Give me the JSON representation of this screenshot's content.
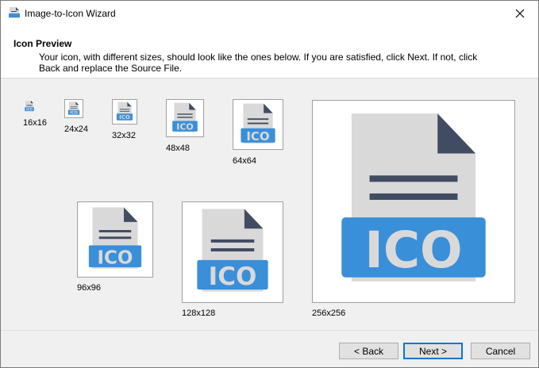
{
  "window": {
    "title": "Image-to-Icon Wizard"
  },
  "header": {
    "title": "Icon Preview",
    "description": "Your icon, with different sizes, should look like the ones below. If you are satisfied, click Next. If not, click Back and replace the Source File."
  },
  "icon_text": "ICO",
  "colors": {
    "page": "#d9d9d9",
    "fold": "#414c63",
    "band": "#3a8fd9",
    "lines": "#414c63",
    "text": "#d9d9d9"
  },
  "previews": [
    {
      "label": "16x16"
    },
    {
      "label": "24x24"
    },
    {
      "label": "32x32"
    },
    {
      "label": "48x48"
    },
    {
      "label": "64x64"
    },
    {
      "label": "96x96"
    },
    {
      "label": "128x128"
    },
    {
      "label": "256x256"
    }
  ],
  "buttons": {
    "back": "< Back",
    "next": "Next >",
    "cancel": "Cancel"
  }
}
